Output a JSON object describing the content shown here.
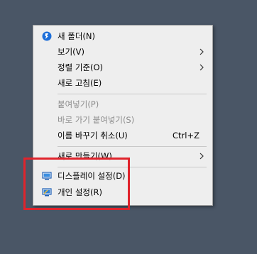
{
  "menu": {
    "items": [
      {
        "label": "새 폴더(N)"
      },
      {
        "label": "보기(V)"
      },
      {
        "label": "정렬 기준(O)"
      },
      {
        "label": "새로 고침(E)"
      },
      {
        "label": "붙여넣기(P)"
      },
      {
        "label": "바로 가기 붙여넣기(S)"
      },
      {
        "label": "이름 바꾸기 취소(U)",
        "shortcut": "Ctrl+Z"
      },
      {
        "label": "새로 만들기(W)"
      },
      {
        "label": "디스플레이 설정(D)"
      },
      {
        "label": "개인 설정(R)"
      }
    ]
  },
  "icons": {
    "new_folder": "shield-badge-icon",
    "submenu": "chevron-right-icon",
    "display": "monitor-icon",
    "personalize": "personalize-monitor-icon"
  },
  "colors": {
    "menu_bg": "#eeeeee",
    "desktop_bg": "#4a5666",
    "highlight_border": "#e0242c",
    "disabled_text": "#8c8c8c"
  }
}
